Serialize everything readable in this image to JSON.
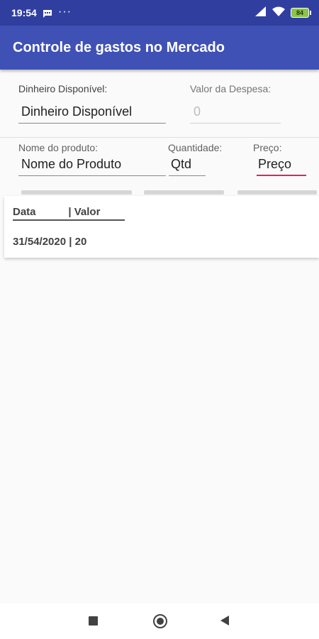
{
  "status_bar": {
    "time": "19:54",
    "dots": "···",
    "battery": "84"
  },
  "app_bar": {
    "title": "Controle de gastos no Mercado"
  },
  "form": {
    "available_label": "Dinheiro Disponível:",
    "available_value": "Dinheiro Disponível",
    "expense_label": "Valor da Despesa:",
    "expense_value": "0",
    "product_label": "Nome do produto:",
    "product_value": "Nome do Produto",
    "quantity_label": "Quantidade:",
    "quantity_value": "Qtd",
    "price_label": "Preço:",
    "price_value": "Preço"
  },
  "list": {
    "header": "Data           | Valor",
    "rows": [
      "31/54/2020 | 20"
    ]
  },
  "colors": {
    "primary": "#3f51b5",
    "primary_dark": "#303f9f",
    "accent": "#e91e63"
  },
  "icons": {
    "message": "message-icon",
    "signal": "signal-icon",
    "wifi": "wifi-icon",
    "battery": "battery-icon"
  }
}
